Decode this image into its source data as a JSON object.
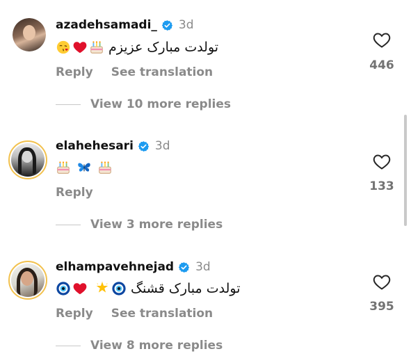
{
  "comments": [
    {
      "username": "azadehsamadi_",
      "time": "3d",
      "text": "تولدت مبارک عزیزم",
      "emojis_before": [
        "kiss-emoji",
        "red-heart-emoji",
        "birthday-cake-emoji"
      ],
      "reply_label": "Reply",
      "translate_label": "See translation",
      "likes": "446",
      "view_more": "View 10 more replies"
    },
    {
      "username": "elahehesari",
      "time": "3d",
      "emojis": [
        "birthday-cake-emoji",
        "blue-butterfly-emoji",
        "birthday-cake-emoji"
      ],
      "reply_label": "Reply",
      "likes": "133",
      "view_more": "View 3 more replies"
    },
    {
      "username": "elhampavehnejad",
      "time": "3d",
      "text": "تولدت مبارک قشنگ",
      "emojis_before": [
        "nazar-amulet-emoji",
        "red-heart-emoji",
        "glowing-star-emoji",
        "nazar-amulet-emoji"
      ],
      "reply_label": "Reply",
      "translate_label": "See translation",
      "likes": "395",
      "view_more": "View 8 more replies"
    }
  ],
  "colors": {
    "verified": "#1d9bf0",
    "muted": "#8a8a8a",
    "ring": "#f2c14e"
  }
}
